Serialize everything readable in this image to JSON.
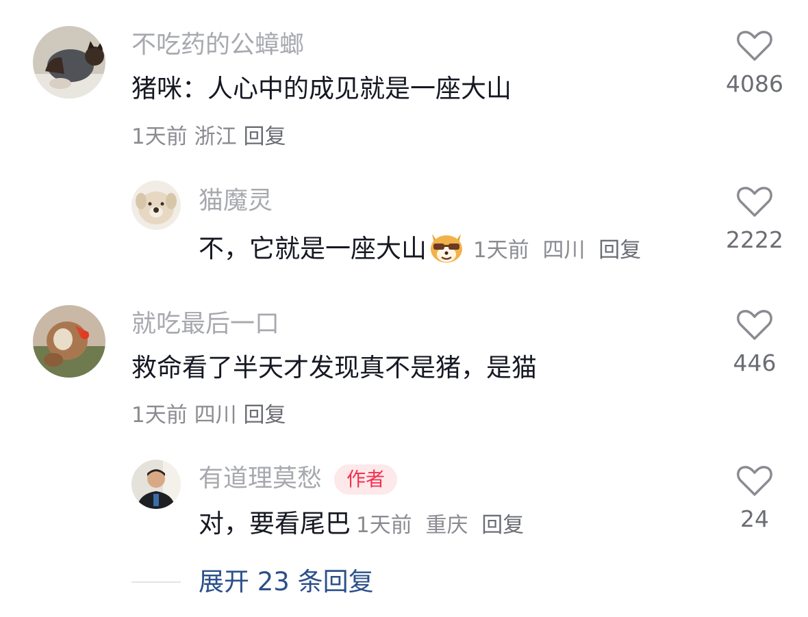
{
  "comments": [
    {
      "username": "不吃药的公蟑螂",
      "text": "猪咪：人心中的成见就是一座大山",
      "time": "1天前",
      "location": "浙江",
      "reply_label": "回复",
      "likes": "4086",
      "avatar_icon": "siamese-cat-avatar"
    },
    {
      "username": "猫魔灵",
      "text": "不，它就是一座大山",
      "emoji": "shiba-dog-sunglasses-emoji",
      "time": "1天前",
      "location": "四川",
      "reply_label": "回复",
      "likes": "2222",
      "avatar_icon": "plush-dog-avatar"
    },
    {
      "username": "就吃最后一口",
      "text": "救命看了半天才发现真不是猪，是猫",
      "time": "1天前",
      "location": "四川",
      "reply_label": "回复",
      "likes": "446",
      "avatar_icon": "monkey-avatar"
    },
    {
      "username": "有道理莫愁",
      "badge": "作者",
      "text": "对，要看尾巴",
      "time": "1天前",
      "location": "重庆",
      "reply_label": "回复",
      "likes": "24",
      "avatar_icon": "person-avatar"
    }
  ],
  "expand_replies": "展开 23 条回复",
  "colors": {
    "username": "#a7a9ae",
    "meta": "#8a8b91",
    "badge_bg": "#fde8ea",
    "badge_text": "#f3304c",
    "expand_link": "#2b4f8a"
  }
}
